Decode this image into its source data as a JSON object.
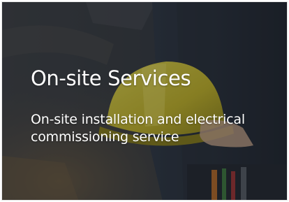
{
  "card": {
    "title": "On-site Services",
    "subtitle": "On-site installation and electrical commissioning service"
  },
  "icons": {
    "background": "worker-with-hard-hat-image"
  },
  "colors": {
    "helmet": "#d8c92a",
    "text": "#ffffff",
    "overlay": "#1c2027"
  }
}
